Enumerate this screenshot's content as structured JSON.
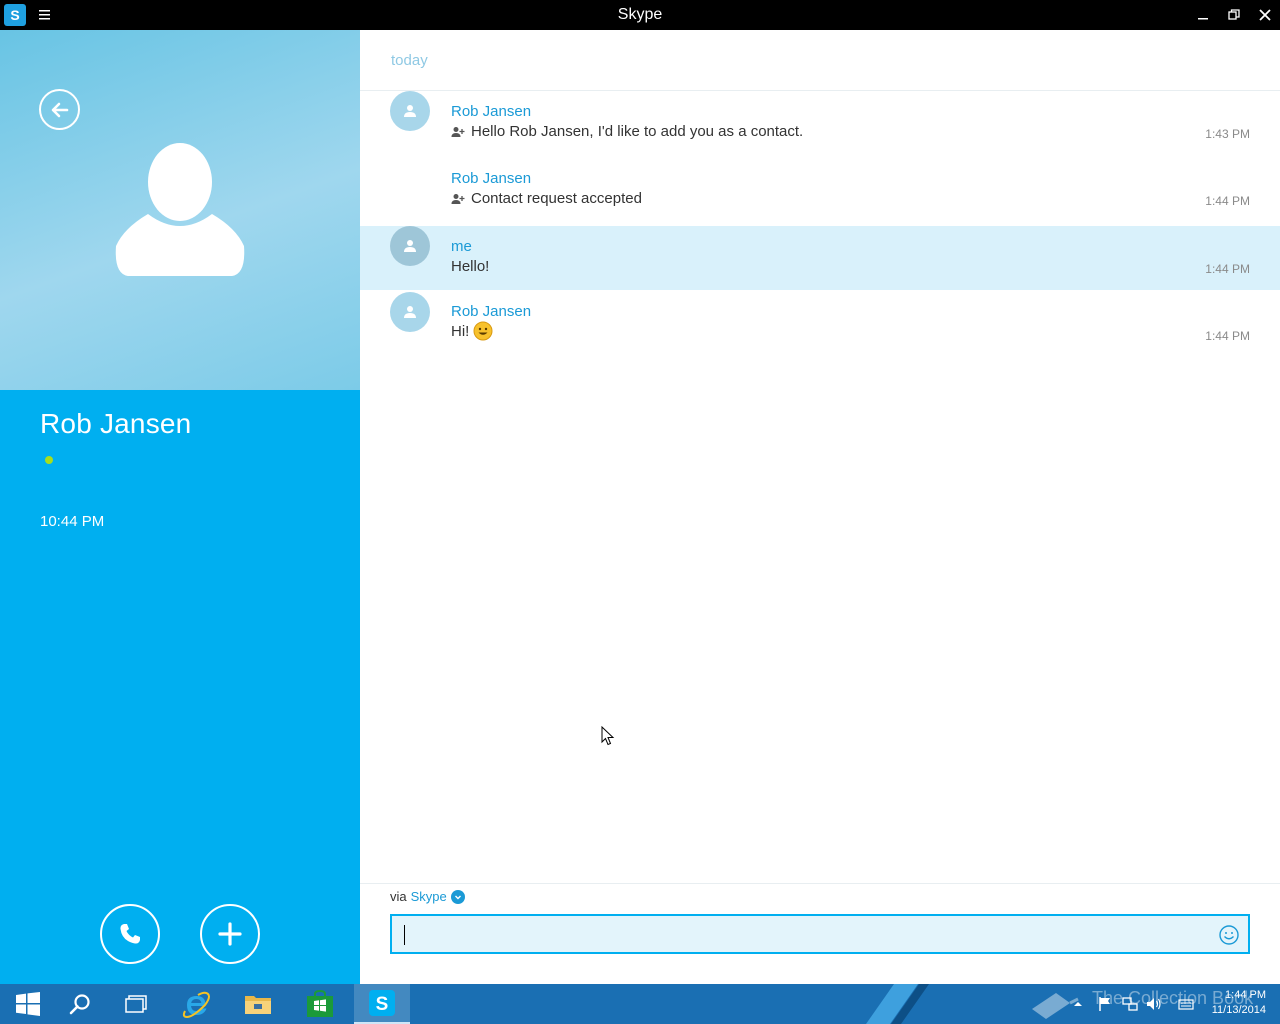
{
  "window": {
    "title": "Skype",
    "app_icon": "skype-logo-icon",
    "menu_icon": "hamburger-menu-icon"
  },
  "contact": {
    "name": "Rob Jansen",
    "presence": "online",
    "presence_color": "#a7de1d",
    "local_time": "10:44 PM"
  },
  "conversation": {
    "day_label": "today",
    "messages": [
      {
        "sender": "Rob Jansen",
        "text": "Hello Rob Jansen, I'd like to add you as a contact.",
        "time": "1:43 PM",
        "icon": "contact-request-icon",
        "show_avatar": true
      },
      {
        "sender": "Rob Jansen",
        "text": "Contact request accepted",
        "time": "1:44 PM",
        "icon": "contact-request-icon",
        "show_avatar": false
      },
      {
        "sender": "me",
        "text": "Hello!",
        "time": "1:44 PM",
        "highlighted": true,
        "show_avatar": true
      },
      {
        "sender": "Rob Jansen",
        "text": "Hi!",
        "time": "1:44 PM",
        "emoji": "smile-emoticon",
        "show_avatar": true
      }
    ]
  },
  "compose": {
    "via_label": "via",
    "via_service": "Skype",
    "value": "",
    "placeholder": ""
  },
  "taskbar": {
    "items": [
      "start-button",
      "search-button",
      "task-view-button",
      "internet-explorer",
      "file-explorer",
      "store",
      "skype"
    ],
    "active": "skype",
    "clock_time": "1:44 PM",
    "clock_date": "11/13/2014",
    "watermark": "The Collection Book"
  },
  "colors": {
    "accent": "#00aff0",
    "link": "#1b9ad6",
    "highlight_row": "#d9f1fb",
    "taskbar": "#1a6fb3"
  }
}
